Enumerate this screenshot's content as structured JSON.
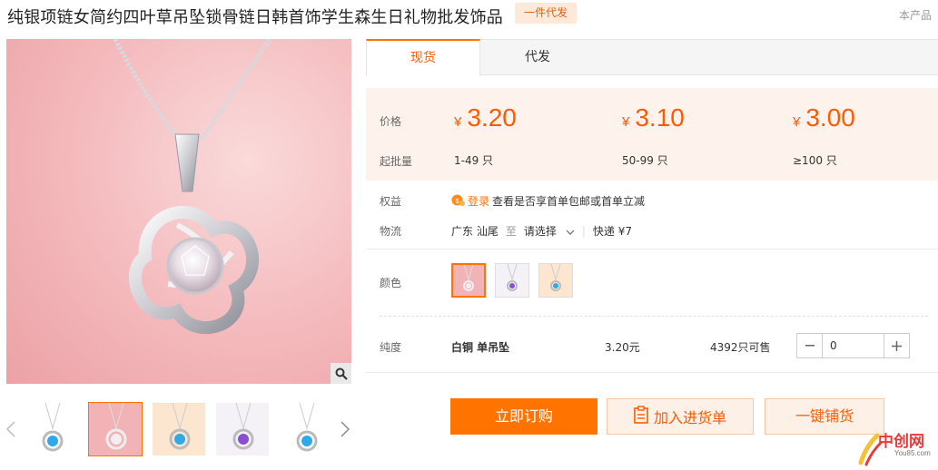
{
  "product": {
    "title": "纯银项链女简约四叶草吊坠锁骨链日韩首饰学生森生日礼物批发饰品",
    "dropship_badge": "一件代发",
    "top_right_text": "本产品"
  },
  "tabs": [
    {
      "label": "现货",
      "active": true
    },
    {
      "label": "代发",
      "active": false
    }
  ],
  "pricing": {
    "price_label": "价格",
    "min_qty_label": "起批量",
    "currency": "¥",
    "tiers": [
      {
        "price": "3.20",
        "qty": "1-49 只"
      },
      {
        "price": "3.10",
        "qty": "50-99 只"
      },
      {
        "price": "3.00",
        "qty": "≥100 只"
      }
    ]
  },
  "benefits": {
    "label": "权益",
    "login_link": "登录",
    "text": "查看是否享首单包邮或首单立减"
  },
  "logistics": {
    "label": "物流",
    "origin": "广东 汕尾",
    "to": "至",
    "destination": "请选择",
    "shipping": "快递 ¥7"
  },
  "color": {
    "label": "颜色",
    "swatches": [
      {
        "name": "pink",
        "active": true
      },
      {
        "name": "purple",
        "active": false
      },
      {
        "name": "blue",
        "active": false
      }
    ]
  },
  "purity": {
    "label": "纯度",
    "sku_name": "白铜 单吊坠",
    "sku_price": "3.20元",
    "stock": "4392只可售",
    "quantity": "0"
  },
  "actions": {
    "order": "立即订购",
    "add_to_cart": "加入进货单",
    "one_click": "一键铺货"
  },
  "watermark": {
    "name": "中创网",
    "url": "You85.com"
  },
  "colors": {
    "accent": "#ff7300",
    "price": "#ff5a00",
    "price_panel_bg": "#fdf3ec"
  }
}
